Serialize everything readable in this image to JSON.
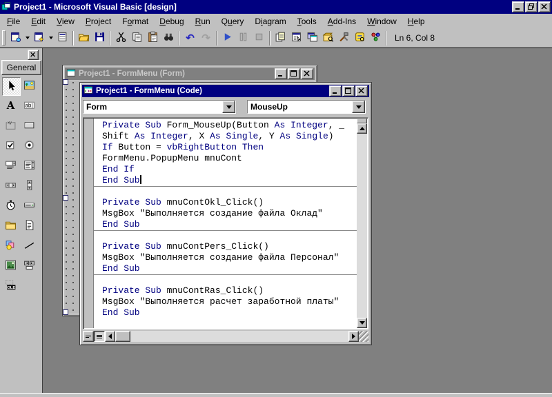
{
  "window": {
    "title": "Project1 - Microsoft Visual Basic [design]",
    "controls": [
      "minimize",
      "restore",
      "close"
    ]
  },
  "menu_bar": {
    "items": [
      {
        "label": "File",
        "u": 0
      },
      {
        "label": "Edit",
        "u": 0
      },
      {
        "label": "View",
        "u": 0
      },
      {
        "label": "Project",
        "u": 0
      },
      {
        "label": "Format",
        "u": 1
      },
      {
        "label": "Debug",
        "u": 0
      },
      {
        "label": "Run",
        "u": 0
      },
      {
        "label": "Query",
        "u": 1
      },
      {
        "label": "Diagram",
        "u": 1
      },
      {
        "label": "Tools",
        "u": 0
      },
      {
        "label": "Add-Ins",
        "u": 0
      },
      {
        "label": "Window",
        "u": 0
      },
      {
        "label": "Help",
        "u": 0
      }
    ]
  },
  "toolbar": {
    "groups": [
      [
        "new-project",
        "add-form",
        "menu-editor"
      ],
      [
        "open-project",
        "save-project"
      ],
      [
        "cut",
        "copy",
        "paste",
        "find"
      ],
      [
        "undo",
        "redo"
      ],
      [
        "start",
        "break",
        "end"
      ],
      [
        "project-explorer",
        "properties-window",
        "form-layout",
        "object-browser",
        "toolbox",
        "data-view",
        "component-manager"
      ]
    ],
    "dropdown_after": [
      "new-project",
      "add-form"
    ],
    "disabled": [
      "redo",
      "break",
      "end"
    ],
    "status": "Ln 6, Col 8"
  },
  "toolbox": {
    "tab": "General",
    "tools": [
      {
        "name": "pointer",
        "selected": true
      },
      {
        "name": "picturebox"
      },
      {
        "name": "label"
      },
      {
        "name": "textbox"
      },
      {
        "name": "frame"
      },
      {
        "name": "commandbutton"
      },
      {
        "name": "checkbox"
      },
      {
        "name": "optionbutton"
      },
      {
        "name": "combobox"
      },
      {
        "name": "listbox"
      },
      {
        "name": "hscrollbar"
      },
      {
        "name": "vscrollbar"
      },
      {
        "name": "timer"
      },
      {
        "name": "drivelistbox"
      },
      {
        "name": "dirlistbox"
      },
      {
        "name": "filelistbox"
      },
      {
        "name": "shape"
      },
      {
        "name": "line"
      },
      {
        "name": "image"
      },
      {
        "name": "data"
      },
      {
        "name": "ole"
      }
    ]
  },
  "form_window": {
    "title": "Project1 - FormMenu (Form)"
  },
  "code_window": {
    "title": "Project1 - FormMenu (Code)",
    "object_dropdown": "Form",
    "event_dropdown": "MouseUp",
    "code_blocks": [
      {
        "lines": [
          {
            "segs": [
              [
                "k",
                "Private Sub"
              ],
              [
                "n",
                " Form_MouseUp(Button "
              ],
              [
                "k",
                "As"
              ],
              [
                "n",
                " "
              ],
              [
                "k",
                "Integer"
              ],
              [
                "n",
                ", _"
              ]
            ]
          },
          {
            "segs": [
              [
                "n",
                "Shift "
              ],
              [
                "k",
                "As"
              ],
              [
                "n",
                " "
              ],
              [
                "k",
                "Integer"
              ],
              [
                "n",
                ", X "
              ],
              [
                "k",
                "As"
              ],
              [
                "n",
                " "
              ],
              [
                "k",
                "Single"
              ],
              [
                "n",
                ", Y "
              ],
              [
                "k",
                "As"
              ],
              [
                "n",
                " "
              ],
              [
                "k",
                "Single"
              ],
              [
                "n",
                ")"
              ]
            ]
          },
          {
            "segs": [
              [
                "k",
                "If"
              ],
              [
                "n",
                " Button = "
              ],
              [
                "k",
                "vbRightButton"
              ],
              [
                "n",
                " "
              ],
              [
                "k",
                "Then"
              ]
            ]
          },
          {
            "segs": [
              [
                "n",
                "FormMenu.PopupMenu mnuCont"
              ]
            ]
          },
          {
            "segs": [
              [
                "k",
                "End If"
              ]
            ]
          },
          {
            "segs": [
              [
                "k",
                "End Sub"
              ]
            ],
            "caret": true
          }
        ]
      },
      {
        "lines": [
          {
            "segs": [
              [
                "k",
                "Private Sub"
              ],
              [
                "n",
                " mnuContOkl_Click()"
              ]
            ]
          },
          {
            "segs": [
              [
                "n",
                "MsgBox \"Выполняется создание файла Оклад\""
              ]
            ]
          },
          {
            "segs": [
              [
                "k",
                "End Sub"
              ]
            ]
          }
        ]
      },
      {
        "lines": [
          {
            "segs": [
              [
                "k",
                "Private Sub"
              ],
              [
                "n",
                " mnuContPers_Click()"
              ]
            ]
          },
          {
            "segs": [
              [
                "n",
                "MsgBox \"Выполняется создание файла Персонал\""
              ]
            ]
          },
          {
            "segs": [
              [
                "k",
                "End Sub"
              ]
            ]
          }
        ]
      },
      {
        "lines": [
          {
            "segs": [
              [
                "k",
                "Private Sub"
              ],
              [
                "n",
                " mnuContRas_Click()"
              ]
            ]
          },
          {
            "segs": [
              [
                "n",
                "MsgBox \"Выполняется расчет заработной платы\""
              ]
            ]
          },
          {
            "segs": [
              [
                "k",
                "End Sub"
              ]
            ]
          }
        ]
      }
    ]
  },
  "colors": {
    "title_active": "#000080",
    "title_inactive": "#808080",
    "chrome": "#c0c0c0",
    "mdi_background": "#808080",
    "keyword": "#000080",
    "code_text": "#000000"
  }
}
